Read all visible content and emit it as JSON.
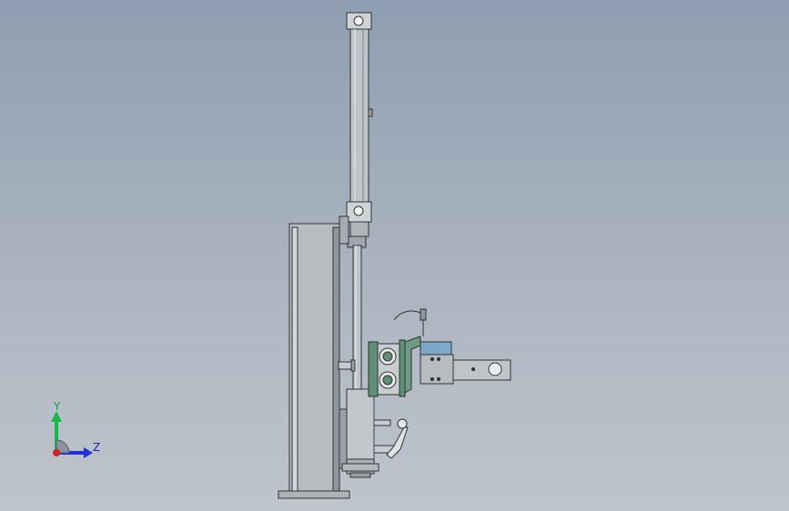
{
  "triad": {
    "y_label": "Y",
    "z_label": "Z",
    "colors": {
      "y": "#19b84a",
      "z": "#2230d8",
      "x": "#d02020"
    }
  },
  "viewport": {
    "background_top": "#8e9db0",
    "background_bottom": "#bec4cb"
  }
}
